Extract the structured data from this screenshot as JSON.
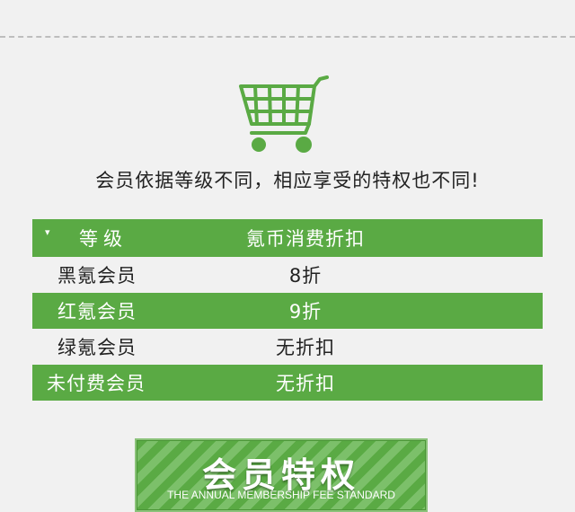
{
  "colors": {
    "accent": "#5aaa44",
    "background": "#f1f1f1"
  },
  "cart_icon": "shopping-cart-icon",
  "tagline": "会员依据等级不同，相应享受的特权也不同!",
  "table": {
    "header": {
      "caret": "▾",
      "level": "等级",
      "discount": "氪币消费折扣"
    },
    "rows": [
      {
        "level": "黑氪会员",
        "discount": "8折"
      },
      {
        "level": "红氪会员",
        "discount": "9折"
      },
      {
        "level": "绿氪会员",
        "discount": "无折扣"
      },
      {
        "level": "未付费会员",
        "discount": "无折扣"
      }
    ]
  },
  "banner": {
    "title": "会员特权",
    "subtitle": "THE ANNUAL MEMBERSHIP FEE STANDARD"
  }
}
